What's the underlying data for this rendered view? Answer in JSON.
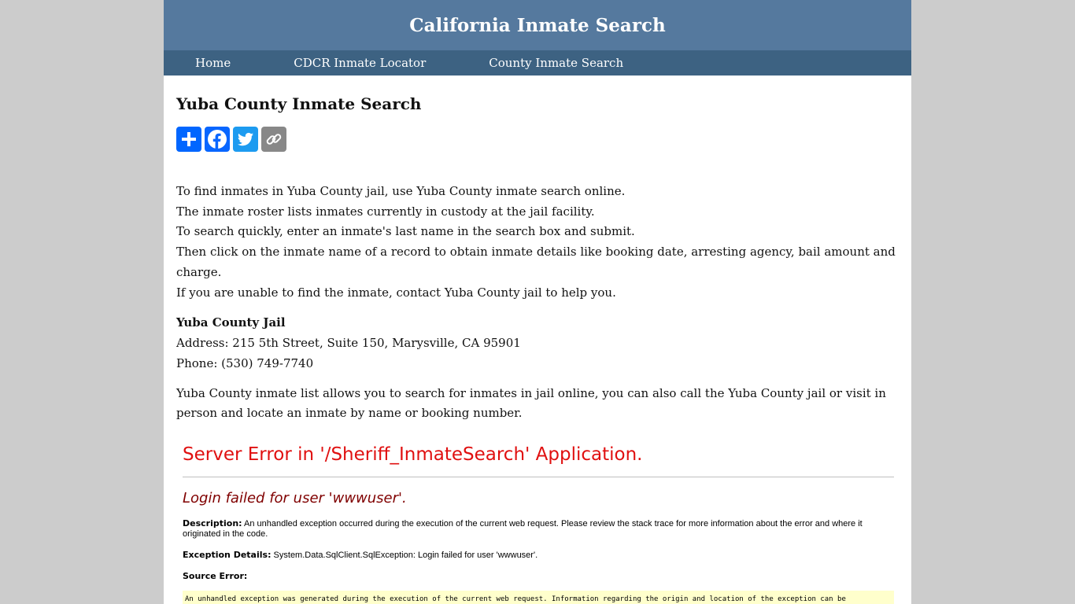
{
  "site": {
    "title": "California Inmate Search"
  },
  "nav": {
    "items": [
      "Home",
      "CDCR Inmate Locator",
      "County Inmate Search"
    ]
  },
  "main": {
    "heading": "Yuba County Inmate Search",
    "intro_lines": [
      "To find inmates in Yuba County jail, use Yuba County inmate search online.",
      "The inmate roster lists inmates currently in custody at the jail facility.",
      "To search quickly, enter an inmate's last name in the search box and submit.",
      "Then click on the inmate name of a record to obtain inmate details like booking date, arresting agency, bail amount and charge.",
      "If you are unable to find the inmate, contact Yuba County jail to help you."
    ],
    "jail": {
      "name": "Yuba County Jail",
      "address": "Address: 215 5th Street, Suite 150, Marysville, CA 95901",
      "phone": "Phone: (530) 749-7740"
    },
    "description": "Yuba County inmate list allows you to search for inmates in jail online, you can also call the Yuba County jail or visit in person and locate an inmate by name or booking number."
  },
  "share": {
    "icons": [
      "share-plus-icon",
      "facebook-icon",
      "twitter-icon",
      "copy-link-icon"
    ],
    "colors": {
      "share": "#0166ff",
      "facebook": "#0866ff",
      "twitter": "#1d9bf0",
      "copy": "#888888"
    }
  },
  "error": {
    "title": "Server Error in '/Sheriff_InmateSearch' Application.",
    "subtitle": "Login failed for user 'wwwuser'.",
    "description_label": "Description:",
    "description_text": "An unhandled exception occurred during the execution of the current web request. Please review the stack trace for more information about the error and where it originated in the code.",
    "exception_label": "Exception Details:",
    "exception_text": "System.Data.SqlClient.SqlException: Login failed for user 'wwwuser'.",
    "source_label": "Source Error:",
    "source_box": "An unhandled exception was generated during the execution of the current web request. Information regarding the origin and location of the exception can be identified using the exception stack trace below."
  }
}
